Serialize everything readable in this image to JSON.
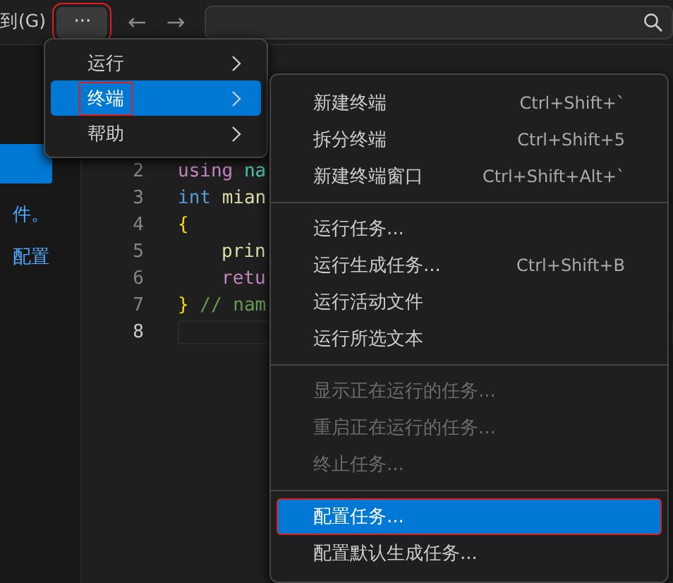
{
  "title_bar": {
    "menu_label": "到(G)",
    "more_button": {
      "label": "···",
      "highlighted": true
    },
    "back_arrow": "←",
    "forward_arrow": "→"
  },
  "sidebar": {
    "texts": [
      {
        "kind": "text",
        "text": "件。"
      },
      {
        "kind": "link",
        "text": "配置"
      }
    ]
  },
  "editor": {
    "lines": [
      {
        "number": "2",
        "current": false,
        "indent": false,
        "tokens": [
          {
            "kind": "keyword",
            "text": "using"
          },
          {
            "kind": "name",
            "text": "na"
          }
        ]
      },
      {
        "number": "3",
        "current": false,
        "indent": false,
        "tokens": [
          {
            "kind": "type",
            "text": "int"
          },
          {
            "kind": "function",
            "text": "mian"
          }
        ]
      },
      {
        "number": "4",
        "current": false,
        "indent": false,
        "tokens": [
          {
            "kind": "brace",
            "text": "{"
          }
        ]
      },
      {
        "number": "5",
        "current": false,
        "indent": true,
        "tokens": [
          {
            "kind": "function",
            "text": "prin"
          }
        ]
      },
      {
        "number": "6",
        "current": false,
        "indent": true,
        "tokens": [
          {
            "kind": "keyword",
            "text": "retu"
          }
        ]
      },
      {
        "number": "7",
        "current": false,
        "indent": false,
        "tokens": [
          {
            "kind": "brace",
            "text": "}"
          },
          {
            "kind": "comment",
            "text": "// nam"
          }
        ]
      },
      {
        "number": "8",
        "current": true
      }
    ]
  },
  "menu": {
    "items": [
      {
        "label": "运行",
        "selected": false,
        "highlighted": false
      },
      {
        "label": "终端",
        "selected": true,
        "highlighted": true
      },
      {
        "label": "帮助",
        "selected": false,
        "highlighted": false
      }
    ]
  },
  "submenu": {
    "groups": [
      {
        "items": [
          {
            "label": "新建终端",
            "shortcut": "Ctrl+Shift+`",
            "disabled": false,
            "selected": false,
            "highlighted": false
          },
          {
            "label": "拆分终端",
            "shortcut": "Ctrl+Shift+5",
            "disabled": false,
            "selected": false,
            "highlighted": false
          },
          {
            "label": "新建终端窗口",
            "shortcut": "Ctrl+Shift+Alt+`",
            "disabled": false,
            "selected": false,
            "highlighted": false
          }
        ]
      },
      {
        "items": [
          {
            "label": "运行任务...",
            "disabled": false,
            "selected": false,
            "highlighted": false
          },
          {
            "label": "运行生成任务...",
            "shortcut": "Ctrl+Shift+B",
            "disabled": false,
            "selected": false,
            "highlighted": false
          },
          {
            "label": "运行活动文件",
            "disabled": false,
            "selected": false,
            "highlighted": false
          },
          {
            "label": "运行所选文本",
            "disabled": false,
            "selected": false,
            "highlighted": false
          }
        ]
      },
      {
        "items": [
          {
            "label": "显示正在运行的任务...",
            "disabled": true,
            "selected": false,
            "highlighted": false
          },
          {
            "label": "重启正在运行的任务...",
            "disabled": true,
            "selected": false,
            "highlighted": false
          },
          {
            "label": "终止任务...",
            "disabled": true,
            "selected": false,
            "highlighted": false
          }
        ]
      },
      {
        "items": [
          {
            "label": "配置任务...",
            "disabled": false,
            "selected": true,
            "highlighted": true
          },
          {
            "label": "配置默认生成任务...",
            "disabled": false,
            "selected": false,
            "highlighted": false
          }
        ]
      }
    ]
  }
}
